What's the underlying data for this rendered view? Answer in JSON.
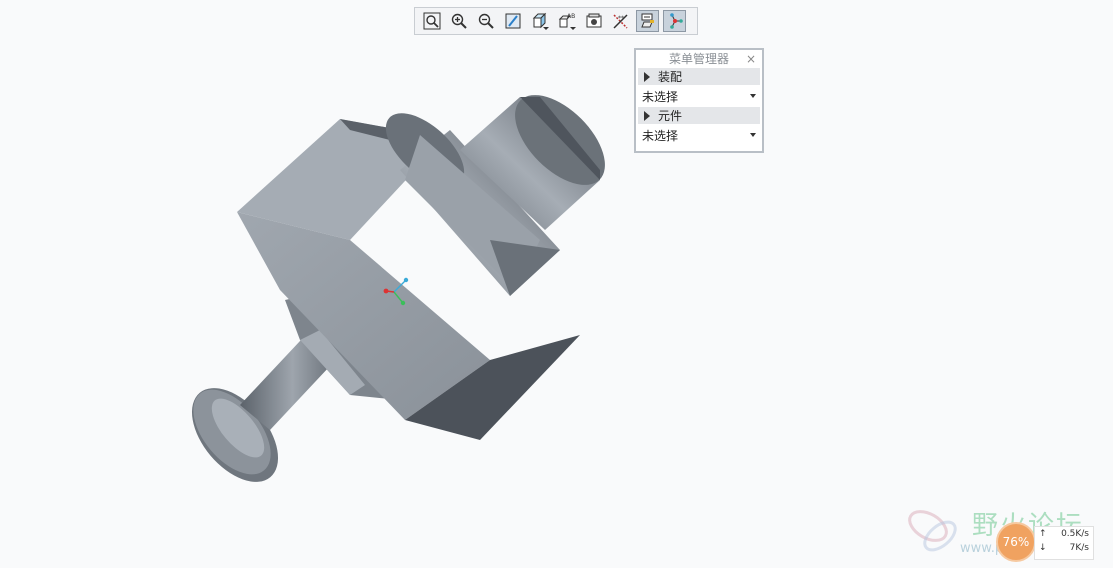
{
  "toolbar": {
    "buttons": [
      {
        "name": "refit-button",
        "icon": "zoom-fit-icon"
      },
      {
        "name": "zoom-in-button",
        "icon": "zoom-in-icon"
      },
      {
        "name": "zoom-out-button",
        "icon": "zoom-out-icon"
      },
      {
        "name": "repaint-button",
        "icon": "repaint-icon"
      },
      {
        "name": "display-style-button",
        "icon": "cube-icon"
      },
      {
        "name": "saved-orientations-button",
        "icon": "view-orient-icon"
      },
      {
        "name": "view-manager-button",
        "icon": "view-manager-icon"
      },
      {
        "name": "datum-display-button",
        "icon": "datum-filter-icon"
      },
      {
        "name": "annotation-display-button",
        "icon": "annotation-icon"
      },
      {
        "name": "spin-center-button",
        "icon": "spin-center-icon"
      }
    ]
  },
  "menu_manager": {
    "title": "菜单管理器",
    "close": "×",
    "assembly_label": "装配",
    "assembly_value": "未选择",
    "component_label": "元件",
    "component_value": "未选择"
  },
  "watermark": {
    "text": "野火论坛",
    "url": "www.proewildfire.cn"
  },
  "network": {
    "percent": "76%",
    "up": "0.5K/s",
    "down": "7K/s"
  },
  "colors": {
    "background": "#f9fafb",
    "model_light": "#8e959e",
    "model_dark": "#4d535b",
    "accent_orange": "#f0a260"
  }
}
